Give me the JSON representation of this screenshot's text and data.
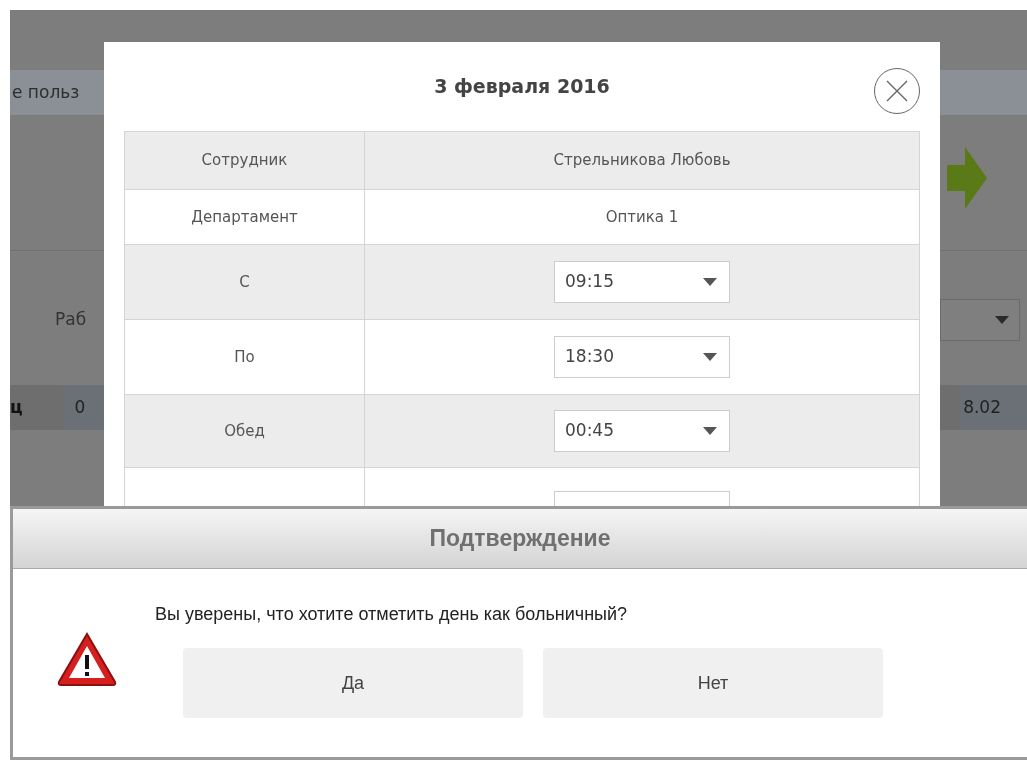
{
  "background": {
    "tab_text": "е польз",
    "label": "Раб",
    "row_header": "ц",
    "cell_first": "0",
    "cell_last": "8.02"
  },
  "day_dialog": {
    "title": "3 февраля 2016",
    "rows": [
      {
        "kind": "text",
        "label": "Сотрудник",
        "value": "Стрельникова Любовь"
      },
      {
        "kind": "text",
        "label": "Департамент",
        "value": "Оптика 1"
      },
      {
        "kind": "select",
        "label": "С",
        "value": "09:15"
      },
      {
        "kind": "select",
        "label": "По",
        "value": "18:30"
      },
      {
        "kind": "select",
        "label": "Обед",
        "value": "00:45"
      },
      {
        "kind": "cut"
      }
    ]
  },
  "confirm": {
    "title": "Подтверждение",
    "message": "Вы уверены, что хотите отметить день как больничный?",
    "buttons": [
      "Да",
      "Нет"
    ]
  }
}
